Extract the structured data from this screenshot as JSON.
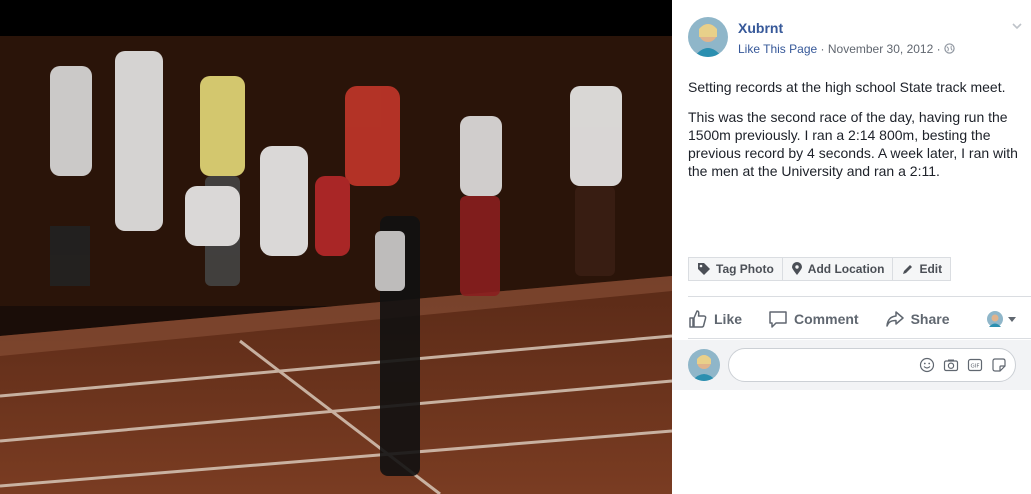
{
  "post": {
    "author": "Xubrnt",
    "like_page": "Like This Page",
    "separator": "·",
    "date": "November 30, 2012",
    "text_p1": "Setting records at the high school State track meet.",
    "text_p2": "This was the second race of the day, having run the 1500m previously. I ran a 2:14 800m, besting the previous record by 4 seconds. A week later, I ran with the men at the University and ran a 2:11."
  },
  "photo_tools": {
    "tag_photo": "Tag Photo",
    "add_location": "Add Location",
    "edit": "Edit"
  },
  "actions": {
    "like": "Like",
    "comment": "Comment",
    "share": "Share"
  },
  "comment": {
    "placeholder": ""
  },
  "colors": {
    "link": "#365899",
    "text": "#1d2129",
    "meta": "#616770",
    "action": "#606770",
    "comment_bg": "#f2f3f5"
  },
  "icons": [
    "tag-icon",
    "location-pin-icon",
    "pencil-icon",
    "thumbs-up-icon",
    "speech-bubble-icon",
    "share-arrow-icon",
    "chevron-down-icon",
    "globe-icon",
    "emoji-icon",
    "camera-icon",
    "gif-icon",
    "sticker-icon"
  ]
}
